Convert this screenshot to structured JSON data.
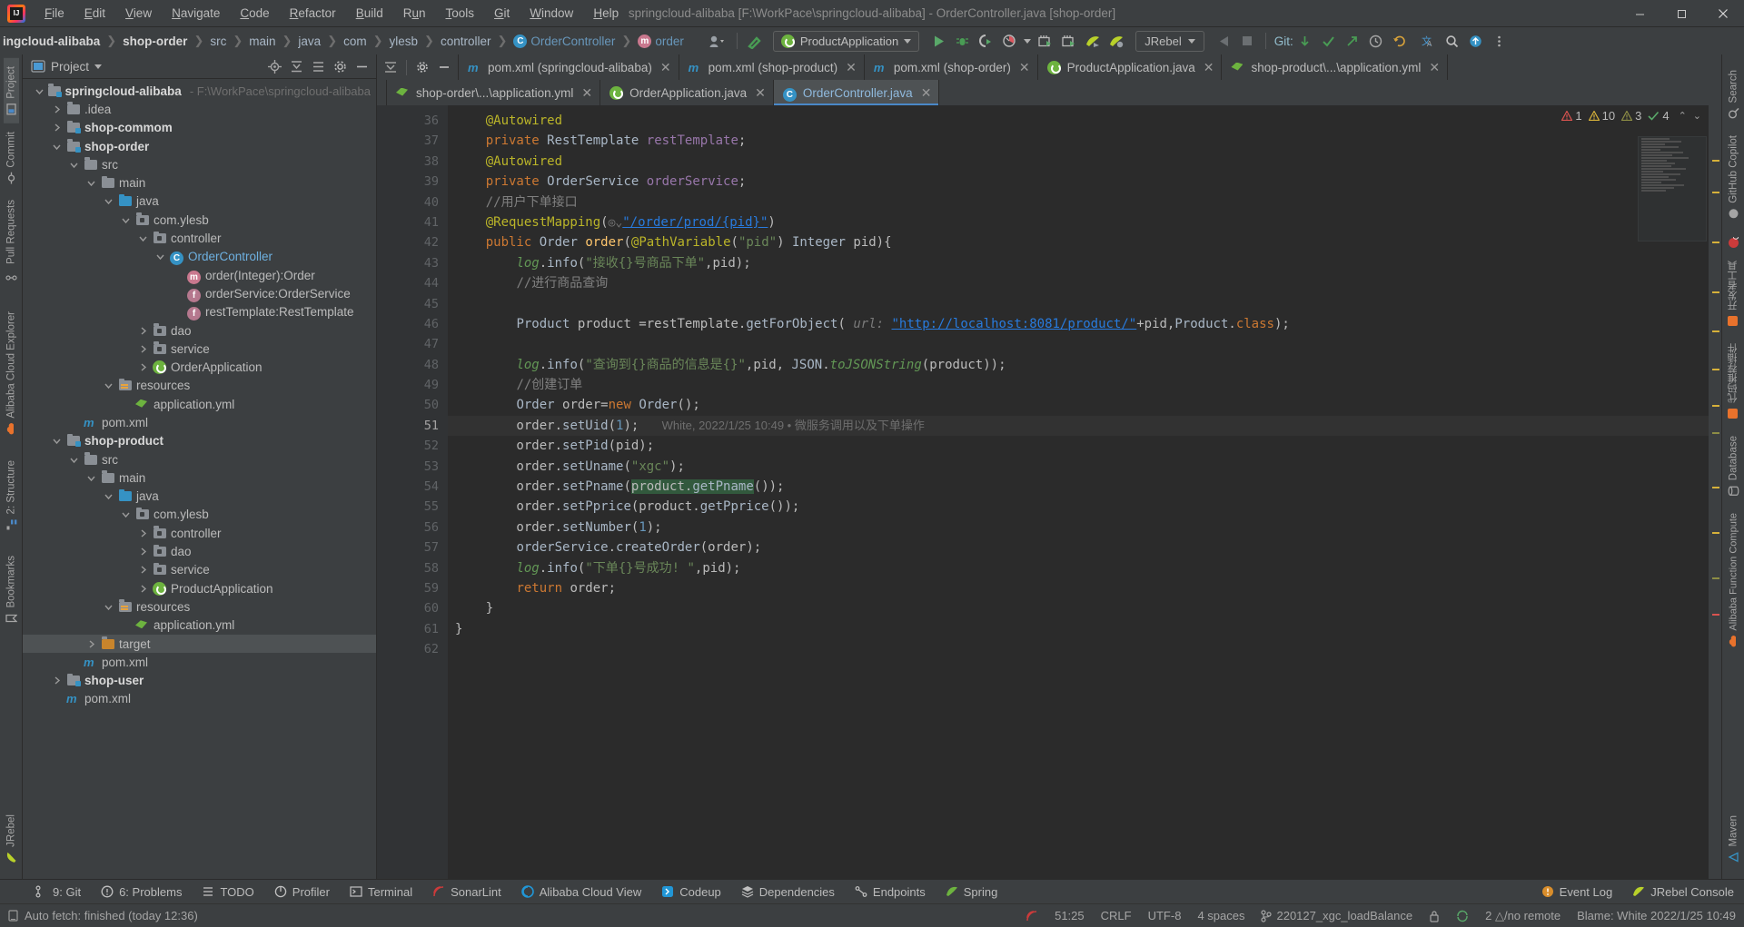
{
  "window": {
    "title": "springcloud-alibaba [F:\\WorkPace\\springcloud-alibaba] - OrderController.java [shop-order]",
    "minimize": "–",
    "maximize": "❐",
    "close": "✕"
  },
  "menu": [
    {
      "label": "File"
    },
    {
      "label": "Edit"
    },
    {
      "label": "View"
    },
    {
      "label": "Navigate"
    },
    {
      "label": "Code"
    },
    {
      "label": "Refactor"
    },
    {
      "label": "Build"
    },
    {
      "label": "Run"
    },
    {
      "label": "Tools"
    },
    {
      "label": "Git"
    },
    {
      "label": "Window"
    },
    {
      "label": "Help"
    }
  ],
  "breadcrumbs": [
    {
      "label": "ingcloud-alibaba",
      "style": "bold"
    },
    {
      "label": "shop-order",
      "style": "bold"
    },
    {
      "label": "src",
      "style": "plain"
    },
    {
      "label": "main",
      "style": "plain"
    },
    {
      "label": "java",
      "style": "plain"
    },
    {
      "label": "com",
      "style": "plain"
    },
    {
      "label": "ylesb",
      "style": "plain"
    },
    {
      "label": "controller",
      "style": "plain"
    },
    {
      "label": "OrderController",
      "style": "blue",
      "icon": "class-icon"
    },
    {
      "label": "order",
      "style": "blue",
      "icon": "method-icon"
    }
  ],
  "toolbar": {
    "run_config": "ProductApplication",
    "jrebel": "JRebel",
    "git_label": "Git:",
    "icons": [
      "profile-icon",
      "hammer-icon",
      "run-icon",
      "debug-icon",
      "coverage-icon",
      "profiler-icon",
      "build-icon",
      "build2-icon",
      "jrebel-run-icon",
      "jrebel-debug-icon",
      "rollback-icon",
      "stop-icon",
      "git-update-icon",
      "git-commit-icon",
      "git-push-icon",
      "history-icon",
      "undo-icon",
      "translate-icon",
      "search-icon",
      "updates-icon",
      "more-icon"
    ]
  },
  "project_panel": {
    "title": "Project",
    "header_icons": [
      "locate-icon",
      "collapse-all-icon",
      "expand-icon",
      "settings-icon",
      "hide-icon"
    ],
    "tree": [
      {
        "depth": 0,
        "arrow": "down",
        "icon": "module-folder",
        "label": "springcloud-alibaba",
        "bold": true,
        "hint": "- F:\\WorkPace\\springcloud-alibaba"
      },
      {
        "depth": 1,
        "arrow": "right",
        "icon": "folder",
        "label": ".idea"
      },
      {
        "depth": 1,
        "arrow": "right",
        "icon": "module-folder",
        "label": "shop-commom",
        "bold": true
      },
      {
        "depth": 1,
        "arrow": "down",
        "icon": "module-folder",
        "label": "shop-order",
        "bold": true
      },
      {
        "depth": 2,
        "arrow": "down",
        "icon": "folder",
        "label": "src"
      },
      {
        "depth": 3,
        "arrow": "down",
        "icon": "folder",
        "label": "main"
      },
      {
        "depth": 4,
        "arrow": "down",
        "icon": "source-folder",
        "label": "java"
      },
      {
        "depth": 5,
        "arrow": "down",
        "icon": "package",
        "label": "com.ylesb"
      },
      {
        "depth": 6,
        "arrow": "down",
        "icon": "package",
        "label": "controller"
      },
      {
        "depth": 7,
        "arrow": "down",
        "icon": "class-icon",
        "label": "OrderController",
        "blue": true
      },
      {
        "depth": 8,
        "arrow": "none",
        "icon": "method-icon",
        "label": "order(Integer):Order"
      },
      {
        "depth": 8,
        "arrow": "none",
        "icon": "field-icon",
        "label": "orderService:OrderService"
      },
      {
        "depth": 8,
        "arrow": "none",
        "icon": "field-icon",
        "label": "restTemplate:RestTemplate"
      },
      {
        "depth": 6,
        "arrow": "right",
        "icon": "package",
        "label": "dao"
      },
      {
        "depth": 6,
        "arrow": "right",
        "icon": "package",
        "label": "service"
      },
      {
        "depth": 6,
        "arrow": "right",
        "icon": "spring-icon",
        "label": "OrderApplication"
      },
      {
        "depth": 4,
        "arrow": "down",
        "icon": "resource-folder",
        "label": "resources"
      },
      {
        "depth": 5,
        "arrow": "none",
        "icon": "yml-icon",
        "label": "application.yml"
      },
      {
        "depth": 2,
        "arrow": "none",
        "icon": "maven-icon",
        "label": "pom.xml"
      },
      {
        "depth": 1,
        "arrow": "down",
        "icon": "module-folder",
        "label": "shop-product",
        "bold": true
      },
      {
        "depth": 2,
        "arrow": "down",
        "icon": "folder",
        "label": "src"
      },
      {
        "depth": 3,
        "arrow": "down",
        "icon": "folder",
        "label": "main"
      },
      {
        "depth": 4,
        "arrow": "down",
        "icon": "source-folder",
        "label": "java"
      },
      {
        "depth": 5,
        "arrow": "down",
        "icon": "package",
        "label": "com.ylesb"
      },
      {
        "depth": 6,
        "arrow": "right",
        "icon": "package",
        "label": "controller"
      },
      {
        "depth": 6,
        "arrow": "right",
        "icon": "package",
        "label": "dao"
      },
      {
        "depth": 6,
        "arrow": "right",
        "icon": "package",
        "label": "service"
      },
      {
        "depth": 6,
        "arrow": "right",
        "icon": "spring-icon",
        "label": "ProductApplication"
      },
      {
        "depth": 4,
        "arrow": "down",
        "icon": "resource-folder",
        "label": "resources"
      },
      {
        "depth": 5,
        "arrow": "none",
        "icon": "yml-icon",
        "label": "application.yml"
      },
      {
        "depth": 3,
        "arrow": "right",
        "icon": "target-folder",
        "label": "target",
        "selected": true
      },
      {
        "depth": 2,
        "arrow": "none",
        "icon": "maven-icon",
        "label": "pom.xml"
      },
      {
        "depth": 1,
        "arrow": "right",
        "icon": "module-folder",
        "label": "shop-user",
        "bold": true
      },
      {
        "depth": 1,
        "arrow": "none",
        "icon": "maven-icon",
        "label": "pom.xml"
      }
    ]
  },
  "left_rail": [
    {
      "label": "Project",
      "icon": "project-icon",
      "active": true
    },
    {
      "label": "Commit",
      "icon": "commit-icon"
    },
    {
      "label": "Pull Requests",
      "icon": "pull-request-icon"
    },
    {
      "label": "",
      "icon": "alibaba-cloud-explorer-icon"
    },
    {
      "label": "Alibaba Cloud Explorer",
      "icon": "cloud-icon"
    },
    {
      "label": "2: Structure",
      "icon": "structure-icon"
    },
    {
      "label": "Bookmarks",
      "icon": "bookmark-icon"
    },
    {
      "label": "JRebel",
      "icon": "jrebel-icon"
    }
  ],
  "right_rail": [
    {
      "label": "Search",
      "icon": "search-icon"
    },
    {
      "label": "GitHub Copilot",
      "icon": "copilot-icon"
    },
    {
      "label": "Notifications",
      "icon": "bell-icon"
    },
    {
      "label": "Database",
      "icon": "database-icon"
    },
    {
      "label": "Alibaba Function Compute",
      "icon": "function-icon"
    },
    {
      "label": "Maven",
      "icon": "maven-icon"
    }
  ],
  "editor_tabs_row1": [
    {
      "label": "pom.xml (springcloud-alibaba)",
      "icon": "maven-icon",
      "active": false
    },
    {
      "label": "pom.xml (shop-product)",
      "icon": "maven-icon",
      "active": false
    },
    {
      "label": "pom.xml (shop-order)",
      "icon": "maven-icon",
      "active": false
    },
    {
      "label": "ProductApplication.java",
      "icon": "spring-icon",
      "active": false
    },
    {
      "label": "shop-product\\...\\application.yml",
      "icon": "yml-icon",
      "active": false
    }
  ],
  "editor_tabs_row2": [
    {
      "label": "shop-order\\...\\application.yml",
      "icon": "yml-icon",
      "active": false
    },
    {
      "label": "OrderApplication.java",
      "icon": "spring-icon",
      "active": false
    },
    {
      "label": "OrderController.java",
      "icon": "class-icon",
      "active": true
    }
  ],
  "inspection_widget": {
    "errors": "1",
    "warnings": "10",
    "weak_warnings": "3",
    "checks": "4",
    "up": "⌃",
    "down": "⌄"
  },
  "code": {
    "first_line_number": 36,
    "lines": [
      {
        "n": 36,
        "html": "    <span class='ann'>@Autowired</span>"
      },
      {
        "n": 37,
        "html": "    <span class='kw'>private</span> <span class='typ'>RestTemplate</span> <span class='fld'>restTemplate</span>;",
        "gutter_icon": "jrebel-bean"
      },
      {
        "n": 38,
        "html": "    <span class='ann'>@Autowired</span>"
      },
      {
        "n": 39,
        "html": "    <span class='kw'>private</span> <span class='typ'>OrderService</span> <span class='fld'>orderService</span>;",
        "gutter_icon": "jrebel-bean"
      },
      {
        "n": 40,
        "html": "    <span class='cmt'>//用户下单接口</span>"
      },
      {
        "n": 41,
        "html": "    <span class='ann'>@RequestMapping</span>(<span class='inlay'>◎⌄</span><span class='str lnk'>\"/order/prod/{pid}\"</span>)"
      },
      {
        "n": 42,
        "html": "    <span class='kw'>public</span> <span class='typ'>Order</span> <span class='st'>order</span>(<span class='ann'>@PathVariable</span>(<span class='str'>\"pid\"</span>) <span class='typ'>Integer</span> pid){",
        "gutter_icon": "gutter-web"
      },
      {
        "n": 43,
        "html": "        <span class='cn'>log</span>.<span class='ident'>info</span>(<span class='str'>\"接收{}号商品下单\"</span>,pid);"
      },
      {
        "n": 44,
        "html": "        <span class='cmt'>//进行商品查询</span>"
      },
      {
        "n": 45,
        "html": ""
      },
      {
        "n": 46,
        "html": "        <span class='typ'>Product</span> product =restTemplate.<span class='ident'>getForObject</span>( <span class='param-hint'>url:</span> <span class='str lnk'>\"http://localhost:8081/product/\"</span>+pid,<span class='typ'>Product</span>.<span class='kw'>class</span>);"
      },
      {
        "n": 47,
        "html": ""
      },
      {
        "n": 48,
        "html": "        <span class='cn'>log</span>.<span class='ident'>info</span>(<span class='str'>\"查询到{}商品的信息是{}\"</span>,pid, <span class='typ'>JSON</span>.<span class='cn'>toJSONString</span>(product));"
      },
      {
        "n": 49,
        "html": "        <span class='cmt'>//创建订单</span>"
      },
      {
        "n": 50,
        "html": "        <span class='typ'>Order</span> order=<span class='kw'>new</span> <span class='typ'>Order</span>();"
      },
      {
        "n": 51,
        "html": "        order.<span class='ident'>setUid</span>(<span class='num'>1</span>);   <span class='vcs-annot'>White, 2022/1/25 10:49 • 微服务调用以及下单操作</span>",
        "gutter_icon": "bulb",
        "highlight": true
      },
      {
        "n": 52,
        "html": "        order.<span class='ident'>setPid</span>(pid);"
      },
      {
        "n": 53,
        "html": "        order.<span class='ident'>setUname</span>(<span class='str'>\"xgc\"</span>);"
      },
      {
        "n": 54,
        "html": "        order.<span class='ident'>setPname</span>(<span class='search-hl'>product.<span class='ident'>getPname</span></span>());"
      },
      {
        "n": 55,
        "html": "        order.<span class='ident'>setPprice</span>(product.<span class='ident'>getPprice</span>());"
      },
      {
        "n": 56,
        "html": "        order.<span class='ident'>setNumber</span>(<span class='num'>1</span>);"
      },
      {
        "n": 57,
        "html": "        <span class='ident'>orderService</span>.<span class='ident'>createOrder</span>(order);"
      },
      {
        "n": 58,
        "html": "        <span class='cn'>log</span>.<span class='ident'>info</span>(<span class='str'>\"下单{}号成功! \"</span>,pid);"
      },
      {
        "n": 59,
        "html": "        <span class='kw'>return</span> order;"
      },
      {
        "n": 60,
        "html": "    }",
        "gutter_icon": "fold-end"
      },
      {
        "n": 61,
        "html": "}"
      },
      {
        "n": 62,
        "html": ""
      }
    ]
  },
  "bottom_tabs": [
    {
      "label": "9: Git",
      "icon": "git-icon"
    },
    {
      "label": "6: Problems",
      "icon": "problems-icon"
    },
    {
      "label": "TODO",
      "icon": "todo-icon"
    },
    {
      "label": "Profiler",
      "icon": "profiler-icon"
    },
    {
      "label": "Terminal",
      "icon": "terminal-icon"
    },
    {
      "label": "SonarLint",
      "icon": "sonarlint-icon"
    },
    {
      "label": "Alibaba Cloud View",
      "icon": "alibaba-icon"
    },
    {
      "label": "Codeup",
      "icon": "codeup-icon"
    },
    {
      "label": "Dependencies",
      "icon": "dependencies-icon"
    },
    {
      "label": "Endpoints",
      "icon": "endpoints-icon"
    },
    {
      "label": "Spring",
      "icon": "spring-icon"
    }
  ],
  "bottom_right_tabs": [
    {
      "label": "Event Log",
      "icon": "event-log-icon"
    },
    {
      "label": "JRebel Console",
      "icon": "jrebel-icon"
    }
  ],
  "status_bar": {
    "message": "Auto fetch: finished (today 12:36)",
    "position": "51:25",
    "line_sep": "CRLF",
    "encoding": "UTF-8",
    "indent": "4 spaces",
    "branch": "220127_xgc_loadBalance",
    "sync": "2 △/no remote",
    "blame": "Blame: White 2022/1/25 10:49"
  }
}
